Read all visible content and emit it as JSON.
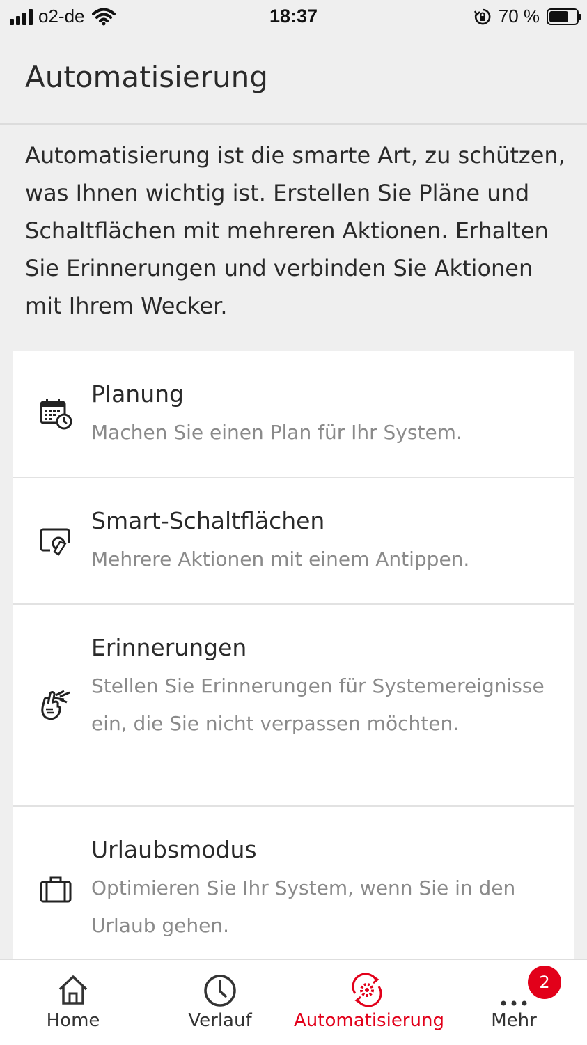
{
  "status_bar": {
    "carrier": "o2-de",
    "time": "18:37",
    "battery": "70 %",
    "battery_level": 0.7
  },
  "header": {
    "title": "Automatisierung"
  },
  "intro": "Automatisierung ist die smarte Art, zu schützen, was Ihnen wichtig ist. Erstellen Sie Pläne und Schaltflächen mit mehreren Aktionen. Erhalten Sie Erinnerungen und verbinden Sie Aktionen mit Ihrem Wecker.",
  "items": [
    {
      "title": "Planung",
      "desc": "Machen Sie einen Plan für Ihr System.",
      "icon": "calendar-clock-icon"
    },
    {
      "title": "Smart-Schaltflächen",
      "desc": "Mehrere Aktionen mit einem Antippen.",
      "icon": "smart-button-icon"
    },
    {
      "title": "Erinnerungen",
      "desc": "Stellen Sie Erinnerungen für Systemereignisse ein, die Sie nicht verpassen möchten.",
      "icon": "reminder-finger-icon"
    },
    {
      "title": "Urlaubsmodus",
      "desc": "Optimieren Sie Ihr System, wenn Sie in den Urlaub gehen.",
      "icon": "suitcase-icon"
    }
  ],
  "tabbar": {
    "tabs": [
      {
        "label": "Home",
        "icon": "home-icon"
      },
      {
        "label": "Verlauf",
        "icon": "clock-icon"
      },
      {
        "label": "Automatisierung",
        "icon": "automation-gear-icon"
      },
      {
        "label": "Mehr",
        "icon": "more-dots-icon"
      }
    ],
    "badge": "2",
    "active_color": "#e2001a"
  }
}
